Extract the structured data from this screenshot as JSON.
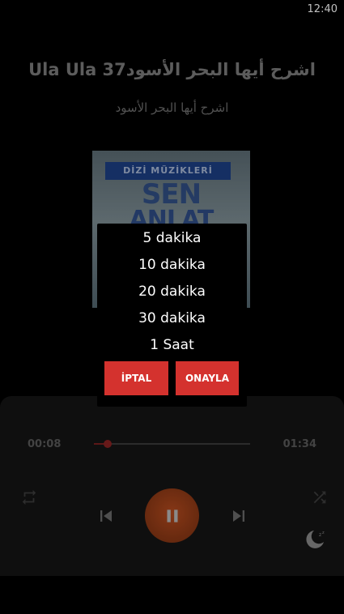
{
  "status_bar": {
    "time": "12:40"
  },
  "song": {
    "title": "Ula Ula 37اشرح أيها البحر الأسود",
    "artist": "اشرح أيها البحر الأسود"
  },
  "album": {
    "banner": "DİZİ MÜZİKLERİ",
    "line1": "SEN",
    "line2": "ANLAT"
  },
  "player": {
    "elapsed": "00:08",
    "total": "01:34",
    "progress": 0.06,
    "accent_color": "#d4322e"
  },
  "sleep_timer_dialog": {
    "options": [
      "5 dakika",
      "10 dakika",
      "20 dakika",
      "30 dakika",
      "1 Saat"
    ],
    "cancel_label": "İPTAL",
    "confirm_label": "ONAYLA"
  },
  "icons": {
    "repeat": "repeat-icon",
    "shuffle": "shuffle-icon",
    "previous": "skip-previous-icon",
    "play_pause": "pause-icon",
    "next": "skip-next-icon",
    "sleep": "sleep-moon-icon"
  }
}
